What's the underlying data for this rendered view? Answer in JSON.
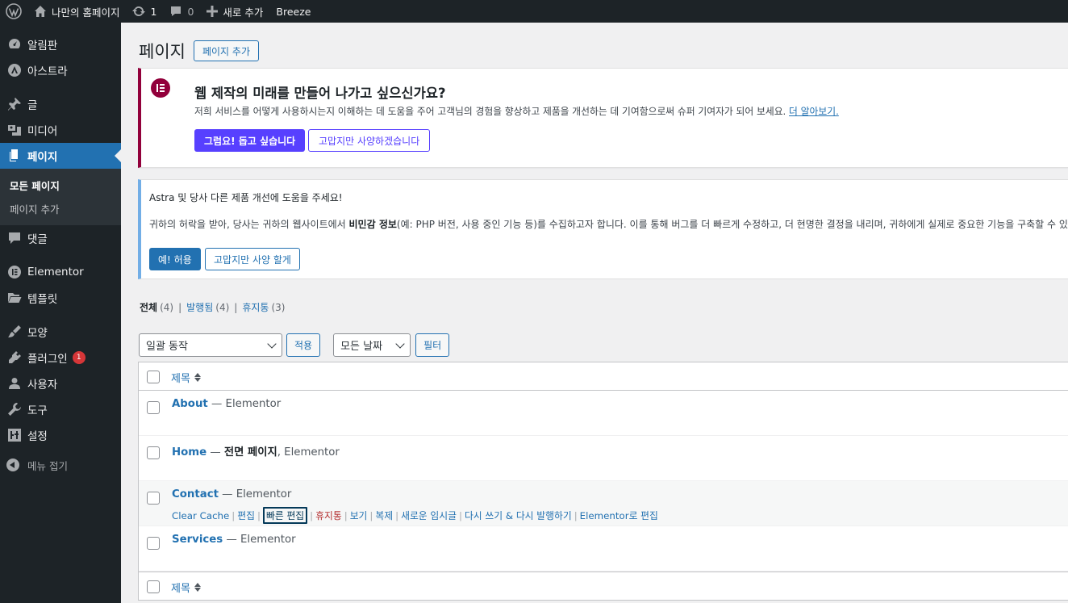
{
  "adminbar": {
    "site_name": "나만의 홈페이지",
    "updates_count": "1",
    "comments_count": "0",
    "new_label": "새로 추가",
    "breeze_label": "Breeze"
  },
  "sidebar": {
    "items": [
      {
        "label": "알림판",
        "icon": "dashboard-icon"
      },
      {
        "label": "아스트라",
        "icon": "astra-icon"
      },
      {
        "label": "글",
        "icon": "pin-icon"
      },
      {
        "label": "미디어",
        "icon": "media-icon"
      },
      {
        "label": "페이지",
        "icon": "pages-icon"
      },
      {
        "label": "댓글",
        "icon": "comments-icon"
      },
      {
        "label": "Elementor",
        "icon": "elementor-icon"
      },
      {
        "label": "템플릿",
        "icon": "folder-icon"
      },
      {
        "label": "모양",
        "icon": "brush-icon"
      },
      {
        "label": "플러그인",
        "icon": "plugin-icon",
        "badge": "1"
      },
      {
        "label": "사용자",
        "icon": "user-icon"
      },
      {
        "label": "도구",
        "icon": "wrench-icon"
      },
      {
        "label": "설정",
        "icon": "settings-icon"
      }
    ],
    "submenu": {
      "all_pages": "모든 페이지",
      "add_page": "페이지 추가"
    },
    "collapse_label": "메뉴 접기"
  },
  "header": {
    "title": "페이지",
    "add_button": "페이지 추가"
  },
  "elementor_notice": {
    "title": "웹 제작의 미래를 만들어 나가고 싶으신가요?",
    "text": "저희 서비스를 어떻게 사용하시는지 이해하는 데 도움을 주어 고객님의 경험을 향상하고 제품을 개선하는 데 기여함으로써 슈퍼 기여자가 되어 보세요.",
    "link": "더 알아보기.",
    "accept": "그럼요! 돕고 싶습니다",
    "decline": "고맙지만 사양하겠습니다"
  },
  "astra_notice": {
    "line1": "Astra 및 당사 다른 제품 개선에 도움을 주세요!",
    "line2_pre": "귀하의 허락을 받아, 당사는 귀하의 웹사이트에서 ",
    "line2_bold": "비민감 정보",
    "line2_post": "(예: PHP 버전, 사용 중인 기능 등)를 수집하고자 합니다. 이를 통해 버그를 더 빠르게 수정하고, 더 현명한 결정을 내리며, 귀하에게 실제로 중요한 기능을 구축할 수 있습",
    "accept": "예! 허용",
    "decline": "고맙지만 사양 할게"
  },
  "filters": {
    "all": "전체",
    "all_count": "(4)",
    "published": "발행됨",
    "published_count": "(4)",
    "trash": "휴지통",
    "trash_count": "(3)"
  },
  "tablenav": {
    "bulk_action": "일괄 동작",
    "apply": "적용",
    "dates": "모든 날짜",
    "filter": "필터"
  },
  "table": {
    "column_title": "제목",
    "rows": [
      {
        "title": "About",
        "state": "Elementor"
      },
      {
        "title": "Home",
        "state_bold": "전면 페이지",
        "state": "Elementor"
      },
      {
        "title": "Contact",
        "state": "Elementor"
      },
      {
        "title": "Services",
        "state": "Elementor"
      }
    ],
    "row_actions": {
      "clear_cache": "Clear Cache",
      "edit": "편집",
      "quick_edit": "빠른 편집",
      "trash": "휴지통",
      "view": "보기",
      "duplicate": "복제",
      "new_draft": "새로운 임시글",
      "rewrite": "다시 쓰기 & 다시 발행하기",
      "elementor_edit": "Elementor로 편집"
    }
  }
}
